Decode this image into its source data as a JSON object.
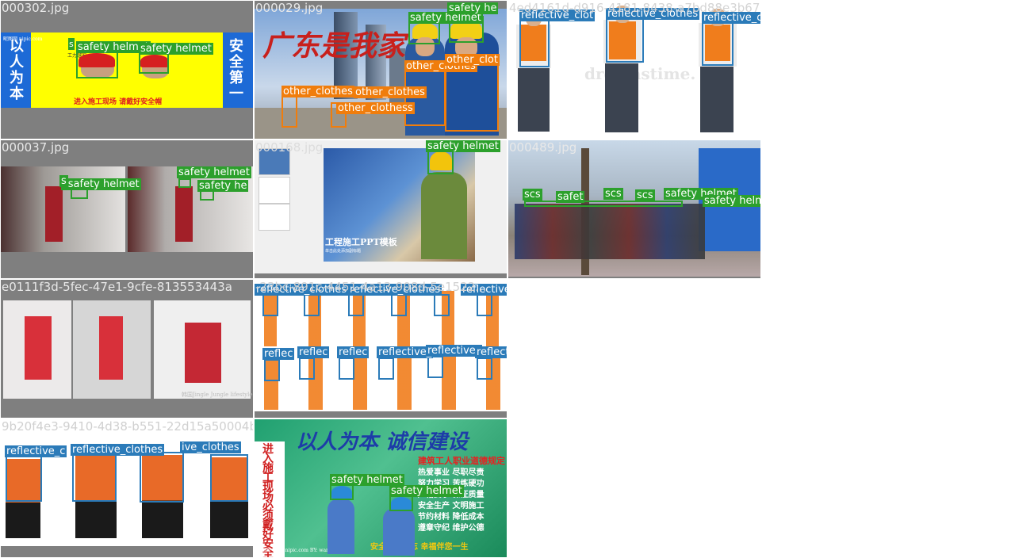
{
  "tiles": [
    {
      "filename": "000302.jpg",
      "texts": [
        "以人为本",
        "安全第一",
        "进入施工现场  请戴好安全帽",
        "昵图网 nipic.com",
        "工力越安"
      ]
    },
    {
      "filename": "000029.jpg",
      "texts": [
        "广东是我家"
      ]
    },
    {
      "filename": "4ed4161d-d916-4181-8438-a7bd88e3b674.jpg",
      "texts": [
        "dreamstime."
      ]
    },
    {
      "filename": "000037.jpg",
      "texts": []
    },
    {
      "filename": "000168.jpg",
      "texts": [
        "工程施工PPT模板",
        "单击此处添加副标题"
      ]
    },
    {
      "filename": "000489.jpg",
      "texts": []
    },
    {
      "filename": "e0111f3d-5fec-47e1-9cfe-813553443a",
      "texts": [
        "韩国Jingle Jungle lifestyle"
      ]
    },
    {
      "filename": "-23bc-891c-4451-4a13-908d-5e1522...",
      "texts": []
    },
    {
      "filename": "9b20f4e3-9410-4d38-b551-22d15a50004b5.jpg",
      "texts": []
    },
    {
      "filename": "",
      "texts": [
        "以人为本  诚信建设",
        "进入施工现场必须戴好安全帽",
        "建筑工人职业道德规定",
        "热爱事业  尽职尽责",
        "努力学习  苦练硬功",
        "严格要求  保证质量",
        "安全生产  文明施工",
        "节约材料  降低成本",
        "遵章守纪  维护公德",
        "安全分秒不忘  幸福伴您一生",
        "昵图网 www.nipic.com  BY: wang"
      ]
    }
  ],
  "labels": {
    "helmet": "safety helmet",
    "helmet_cut_he": "safety he",
    "helmet_cut_s": "safety helmet",
    "other": "other_clothes",
    "other_cut": "other_clot",
    "other_clothess": "other_clothess",
    "reflective": "reflective_clothes",
    "reflective_cut": "reflective_clot",
    "refl_short": "reflec",
    "reflective_s": "reflective_",
    "reflec_ive": "reflective_c",
    "ive": "ive_clothes",
    "s": "s",
    "ss": "ssafety helmet",
    "safety_he": "safety he",
    "scs": "scs",
    "safety_short": "safet"
  },
  "colors": {
    "helmet": "#2ca02c",
    "other": "#f07d0c",
    "reflective": "#2b7bb9",
    "tile_bg": "#7f7f7f"
  }
}
